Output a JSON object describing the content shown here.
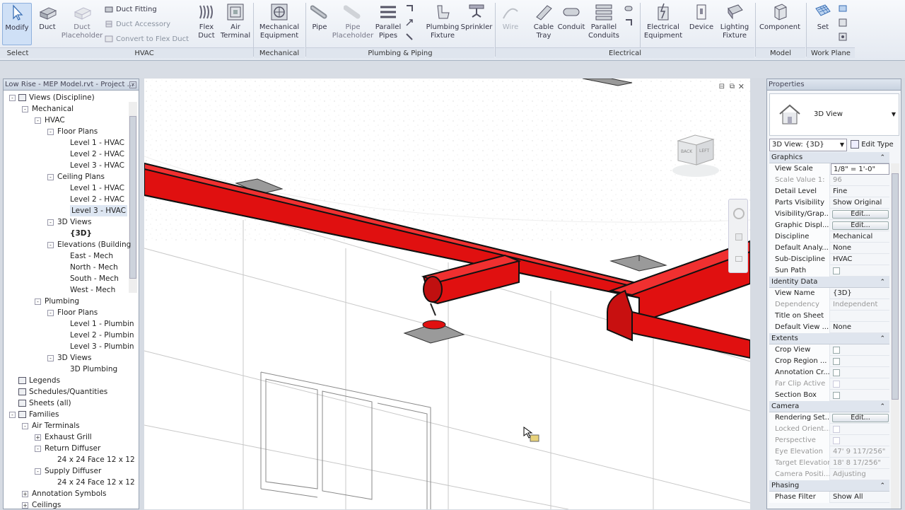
{
  "ribbon": {
    "modify_label": "Modify",
    "duct_label": "Duct",
    "duct_placeholder_label": "Duct\nPlaceholder",
    "duct_fitting_label": "Duct Fitting",
    "duct_accessory_label": "Duct Accessory",
    "convert_flex_label": "Convert to Flex Duct",
    "flex_duct_label": "Flex\nDuct",
    "air_terminal_label": "Air\nTerminal",
    "mech_equipment_label": "Mechanical\nEquipment",
    "pipe_label": "Pipe",
    "pipe_placeholder_label": "Pipe\nPlaceholder",
    "parallel_pipes_label": "Parallel\nPipes",
    "plumbing_fixture_label": "Plumbing\nFixture",
    "sprinkler_label": "Sprinkler",
    "wire_label": "Wire",
    "cable_tray_label": "Cable\nTray",
    "conduit_label": "Conduit",
    "parallel_conduits_label": "Parallel\nConduits",
    "electrical_equipment_label": "Electrical\nEquipment",
    "device_label": "Device",
    "lighting_fixture_label": "Lighting\nFixture",
    "component_label": "Component",
    "set_label": "Set",
    "panels": {
      "select": "Select",
      "hvac": "HVAC",
      "mechanical": "Mechanical",
      "plumbing": "Plumbing & Piping",
      "electrical": "Electrical",
      "model": "Model",
      "workplane": "Work Plane"
    }
  },
  "browser": {
    "title": "Low Rise - MEP Model.rvt - Project ...",
    "rows": [
      "Views (Discipline)",
      "Mechanical",
      "HVAC",
      "Floor Plans",
      "Level 1 - HVAC",
      "Level 2 - HVAC",
      "Level 3 - HVAC",
      "Ceiling Plans",
      "Level 1 - HVAC",
      "Level 2 - HVAC",
      "Level 3 - HVAC",
      "3D Views",
      "{3D}",
      "Elevations (Building",
      "East - Mech",
      "North - Mech",
      "South - Mech",
      "West - Mech",
      "Plumbing",
      "Floor Plans",
      "Level 1 - Plumbin",
      "Level 2 - Plumbin",
      "Level 3 - Plumbin",
      "3D Views",
      "3D Plumbing",
      "Legends",
      "Schedules/Quantities",
      "Sheets (all)",
      "Families",
      "Air Terminals",
      "Exhaust Grill",
      "Return Diffuser",
      "24 x 24 Face 12 x 12",
      "Supply Diffuser",
      "24 x 24 Face 12 x 12",
      "Annotation Symbols",
      "Ceilings"
    ]
  },
  "viewcube": {
    "back": "BACK",
    "left": "LEFT"
  },
  "properties": {
    "title": "Properties",
    "type_name": "3D View",
    "selector": "3D View: {3D}",
    "edit_type": "Edit Type",
    "sections": {
      "graphics": "Graphics",
      "identity": "Identity Data",
      "extents": "Extents",
      "camera": "Camera",
      "phasing": "Phasing"
    },
    "rows": {
      "view_scale": [
        "View Scale",
        "1/8\" = 1'-0\""
      ],
      "scale_value": [
        "Scale Value    1:",
        "96"
      ],
      "detail_level": [
        "Detail Level",
        "Fine"
      ],
      "parts_visibility": [
        "Parts Visibility",
        "Show Original"
      ],
      "visibility_graphics": [
        "Visibility/Grap...",
        "Edit..."
      ],
      "graphic_display": [
        "Graphic Displ...",
        "Edit..."
      ],
      "discipline": [
        "Discipline",
        "Mechanical"
      ],
      "default_analysis": [
        "Default Analy...",
        "None"
      ],
      "sub_discipline": [
        "Sub-Discipline",
        "HVAC"
      ],
      "sun_path": [
        "Sun Path",
        ""
      ],
      "view_name": [
        "View Name",
        "{3D}"
      ],
      "dependency": [
        "Dependency",
        "Independent"
      ],
      "title_on_sheet": [
        "Title on Sheet",
        ""
      ],
      "default_view": [
        "Default View ...",
        "None"
      ],
      "crop_view": [
        "Crop View",
        ""
      ],
      "crop_region": [
        "Crop Region ...",
        ""
      ],
      "annotation_crop": [
        "Annotation Cr...",
        ""
      ],
      "far_clip": [
        "Far Clip Active",
        ""
      ],
      "section_box": [
        "Section Box",
        ""
      ],
      "rendering_settings": [
        "Rendering Set...",
        "Edit..."
      ],
      "locked_orientation": [
        "Locked Orient...",
        ""
      ],
      "perspective": [
        "Perspective",
        ""
      ],
      "eye_elevation": [
        "Eye Elevation",
        "47'  9 117/256\""
      ],
      "target_elevation": [
        "Target Elevation",
        "18'  8 17/256\""
      ],
      "camera_position": [
        "Camera Positi...",
        "Adjusting"
      ],
      "phase_filter": [
        "Phase Filter",
        "Show All"
      ]
    }
  },
  "colors": {
    "duct_red": "#e01010",
    "duct_dark": "#b00000",
    "ribbon_bg": "#eef2f7",
    "panel_header": "#dfe5ee"
  }
}
